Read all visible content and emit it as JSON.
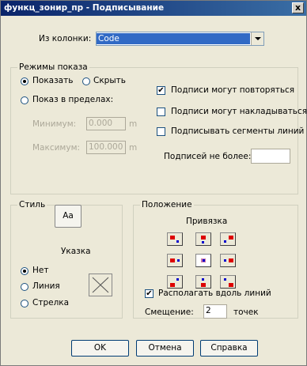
{
  "window": {
    "title": "функц_зонир_пр - Подписывание",
    "close": "x"
  },
  "column": {
    "label": "Из колонки:",
    "value": "Code"
  },
  "modes": {
    "title": "Режимы показа",
    "show": "Показать",
    "hide": "Скрыть",
    "range": "Показ в пределах:",
    "min_label": "Минимум:",
    "min_value": "0.000",
    "min_unit": "m",
    "max_label": "Максимум:",
    "max_value": "100.000",
    "max_unit": "m",
    "repeat": "Подписи могут повторяться",
    "overlap": "Подписи могут накладываться",
    "segments": "Подписывать сегменты линий",
    "max_count": "Подписей не более:",
    "max_count_value": ""
  },
  "style": {
    "title": "Стиль",
    "font_button": "Aa",
    "pointer_label": "Указка",
    "none": "Нет",
    "line": "Линия",
    "arrow": "Стрелка"
  },
  "position": {
    "title": "Положение",
    "anchor_label": "Привязка",
    "along_lines": "Располагать вдоль линий",
    "offset_label": "Смещение:",
    "offset_value": "2",
    "offset_unit": "точек"
  },
  "buttons": {
    "ok": "OK",
    "cancel": "Отмена",
    "help": "Справка"
  }
}
